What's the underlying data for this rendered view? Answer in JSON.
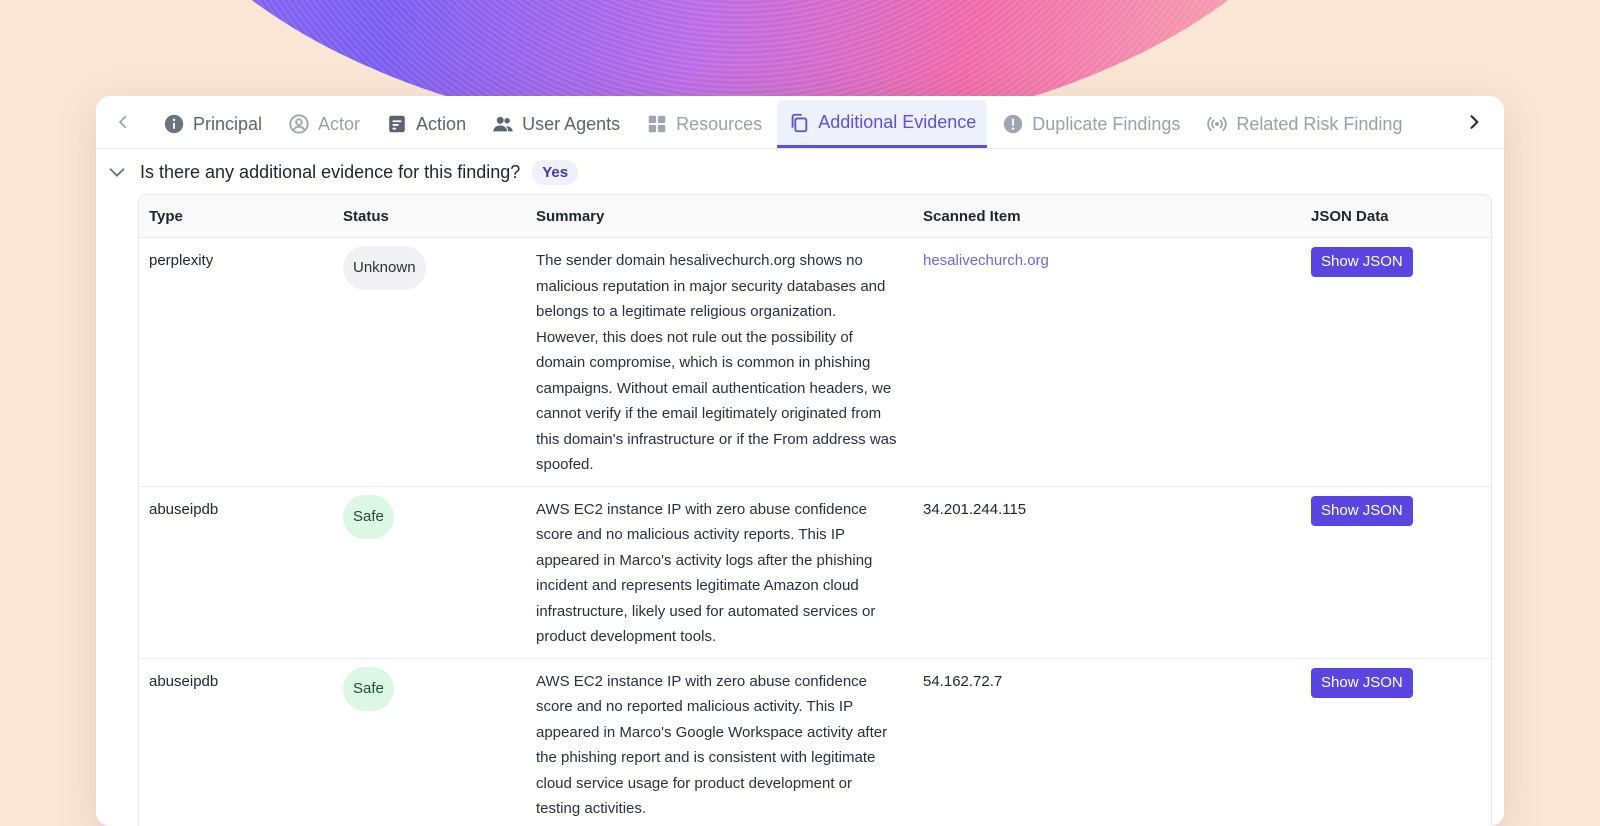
{
  "tabs": [
    {
      "label": "Principal",
      "icon": "info-icon",
      "state": "normal"
    },
    {
      "label": "Actor",
      "icon": "user-circle-icon",
      "state": "muted"
    },
    {
      "label": "Action",
      "icon": "document-icon",
      "state": "normal"
    },
    {
      "label": "User Agents",
      "icon": "users-icon",
      "state": "normal"
    },
    {
      "label": "Resources",
      "icon": "grid-icon",
      "state": "muted"
    },
    {
      "label": "Additional Evidence",
      "icon": "copy-icon",
      "state": "active"
    },
    {
      "label": "Duplicate Findings",
      "icon": "alert-icon",
      "state": "muted"
    },
    {
      "label": "Related Risk Finding",
      "icon": "broadcast-icon",
      "state": "muted"
    }
  ],
  "question": {
    "text": "Is there any additional evidence for this finding?",
    "answer": "Yes"
  },
  "table": {
    "headers": {
      "type": "Type",
      "status": "Status",
      "summary": "Summary",
      "scanned": "Scanned Item",
      "json": "JSON Data"
    },
    "rows": [
      {
        "type": "perplexity",
        "status": "Unknown",
        "summary": "The sender domain hesalivechurch.org shows no malicious reputation in major security databases and belongs to a legitimate religious organization. However, this does not rule out the possibility of domain compromise, which is common in phishing campaigns. Without email authentication headers, we cannot verify if the email legitimately originated from this domain's infrastructure or if the From address was spoofed.",
        "scanned": "hesalivechurch.org",
        "json_button": "Show JSON"
      },
      {
        "type": "abuseipdb",
        "status": "Safe",
        "summary": "AWS EC2 instance IP with zero abuse confidence score and no malicious activity reports. This IP appeared in Marco's activity logs after the phishing incident and represents legitimate Amazon cloud infrastructure, likely used for automated services or product development tools.",
        "scanned": "34.201.244.115",
        "json_button": "Show JSON"
      },
      {
        "type": "abuseipdb",
        "status": "Safe",
        "summary": "AWS EC2 instance IP with zero abuse confidence score and no reported malicious activity. This IP appeared in Marco's Google Workspace activity after the phishing report and is consistent with legitimate cloud service usage for product development or testing activities.",
        "scanned": "54.162.72.7",
        "json_button": "Show JSON"
      }
    ]
  },
  "colors": {
    "accent": "#5a52d8",
    "button": "#5a45e0",
    "safe_bg": "#dcf8e5",
    "unknown_bg": "#f1f1f3"
  }
}
